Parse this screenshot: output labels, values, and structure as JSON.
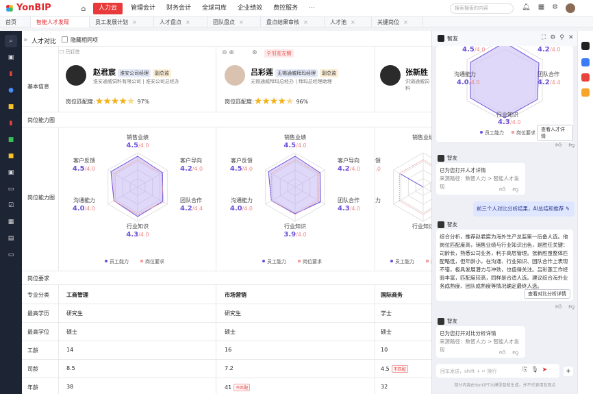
{
  "app": {
    "brand": "YonBIP",
    "search_placeholder": "搜索搜索的内容"
  },
  "nav": {
    "items": [
      "人力云",
      "管理会计",
      "财务会计",
      "全球司库",
      "企业绩效",
      "费控服务"
    ],
    "more": "···"
  },
  "tabs": [
    {
      "label": "首页"
    },
    {
      "label": "智能人才发现"
    },
    {
      "label": "员工发展计划"
    },
    {
      "label": "人才盘点"
    },
    {
      "label": "团队盘点"
    },
    {
      "label": "盘点结果审核"
    },
    {
      "label": "人才池"
    },
    {
      "label": "关键岗位"
    }
  ],
  "compare": {
    "title": "人才对比",
    "hide_same": "隐藏相同项",
    "sections": {
      "basic": "基本信息",
      "ability": "岗位能力图",
      "ability_row": "岗位能力图",
      "req": "岗位要求"
    },
    "match_label": "岗位匹配度:"
  },
  "people": [
    {
      "pin": "已钉住",
      "name": "赵君宸",
      "title": "淮安公司经理",
      "level": "副总监",
      "org": "淮安通威饲料有限公司",
      "pos": "淮安公司总经办",
      "stars": 4.5,
      "match": "97%",
      "radar": {
        "销售业绩": [
          "4.5",
          "/4.0"
        ],
        "客户导向": [
          "4.2",
          "/4.0"
        ],
        "团队合作": [
          "4.2",
          "/4.4"
        ],
        "行业知识": [
          "4.3",
          "/4.0"
        ],
        "沟通能力": [
          "4.0",
          "/4.0"
        ],
        "客户反馈": [
          "4.5",
          "/4.0"
        ]
      },
      "req": [
        "工商管理",
        "研究生",
        "硕士",
        "14",
        "8.5",
        "38"
      ],
      "warn": [
        false,
        false,
        false,
        false,
        false,
        false
      ]
    },
    {
      "pin": "钉在左侧",
      "name": "吕彩莲",
      "title": "无锡通威拜玛经理",
      "level": "副总监",
      "org": "无锡通威拜玛总经办",
      "pos": "拜玛总经理助理",
      "stars": 4.5,
      "match": "96%",
      "radar": {
        "销售业绩": [
          "4.5",
          "/4.0"
        ],
        "客户导向": [
          "4.2",
          "/4.0"
        ],
        "团队合作": [
          "4.3",
          "/4.0"
        ],
        "行业知识": [
          "3.9",
          "/4.0"
        ],
        "沟通能力": [
          "4.0",
          "/4.0"
        ],
        "客户反馈": [
          "4.5",
          "/4.0"
        ]
      },
      "req": [
        "市场营销",
        "研究生",
        "硕士",
        "16",
        "7.2",
        "41"
      ],
      "warn": [
        false,
        false,
        false,
        false,
        false,
        true
      ]
    },
    {
      "pin": "",
      "name": "张新胜",
      "title": "",
      "level": "",
      "org": "洪湖通威饲料",
      "pos": "",
      "stars": 0,
      "match": "",
      "radar": {
        "销售业绩": [
          "",
          ""
        ],
        "客户导向": [
          "",
          ""
        ],
        "团队合作": [
          "",
          ""
        ],
        "行业知识": [
          "",
          ""
        ],
        "沟通能力": [
          "",
          ""
        ],
        "客户反馈": [
          "3.8",
          "/4.0"
        ]
      },
      "req": [
        "国际商务",
        "学士",
        "硕士",
        "10",
        "4.5",
        "32"
      ],
      "warn": [
        false,
        false,
        false,
        false,
        true,
        false
      ]
    }
  ],
  "req_labels": [
    "专业分类",
    "最高学历",
    "最高学位",
    "工龄",
    "司龄",
    "年龄"
  ],
  "warn_text": "不匹配",
  "legend": {
    "emp": "员工能力",
    "req": "岗位要求"
  },
  "panel": {
    "title": "智友",
    "top_card": {
      "labels": {
        "a": "4.5",
        "b": "/4.0",
        "c": "4.2",
        "d": "/4.0",
        "comm": "沟通能力",
        "comm_v": "4.0",
        "comm_r": "/4.0",
        "team": "团队合作",
        "team_v": "4.2",
        "team_r": "/4.4",
        "ind": "行业知识",
        "ind_v": "4.3",
        "ind_r": "/4.0"
      },
      "btn": "查看人才详情"
    },
    "msg1": {
      "bot": "智友",
      "text": "已为您打开人才详情",
      "path": "来源路径：数智人力 > 智能人才发现"
    },
    "user_msg": "前三个人对比分析结果，AI总结和推荐",
    "msg2": {
      "bot": "智友",
      "text": "综合分析，推荐赵君宸为海外生产总监第一后备人选。他岗位匹配度高，销售业绩与行业知识出色，是胜任关键：司龄长，熟悉公司业务，利于高层管理。张新胜虽整体匹配略低，但年龄小，在沟通、行业知识、团队合作上表现不错，极具发展潜力与冲劲，也值得关注。吕彩莲工作经验丰富，匹配度较高，同样是合适人选。建议综合海外业务成熟度、团队成熟度等情况确定最终人选。",
      "btn": "查看对比分析详情"
    },
    "msg3": {
      "bot": "智友",
      "text": "已为您打开对比分析详情",
      "path": "来源路径：数智人力 > 智能人才发现"
    },
    "input_placeholder": "回车发送，shift + ↵ 换行",
    "footer": "部分内容由YonGPT大模型智能生成，并不代表用友观点"
  },
  "colors": {
    "brand": "#e0262b",
    "purple": "#6b4fd8"
  }
}
